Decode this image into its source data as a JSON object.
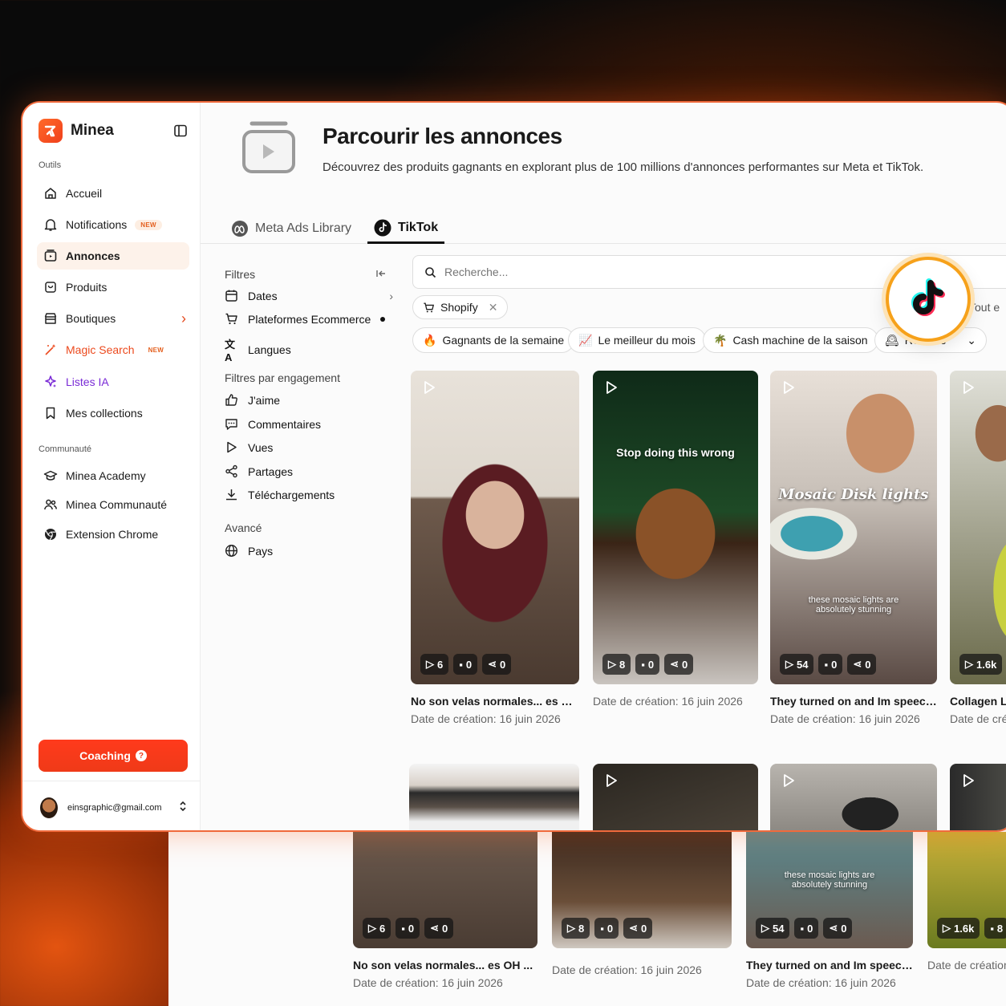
{
  "app": {
    "name": "Minea"
  },
  "sidebar": {
    "section_tools": "Outils",
    "items": [
      {
        "label": "Accueil",
        "icon": "home-icon"
      },
      {
        "label": "Notifications",
        "icon": "bell-icon",
        "badge": "NEW"
      },
      {
        "label": "Annonces",
        "icon": "ads-icon",
        "active": true
      },
      {
        "label": "Produits",
        "icon": "product-icon"
      },
      {
        "label": "Boutiques",
        "icon": "store-icon"
      },
      {
        "label": "Magic Search",
        "icon": "magic-wand-icon",
        "badge": "NEW"
      },
      {
        "label": "Listes IA",
        "icon": "sparkle-icon"
      },
      {
        "label": "Mes collections",
        "icon": "bookmark-icon"
      }
    ],
    "section_community": "Communauté",
    "community": [
      {
        "label": "Minea Academy",
        "icon": "graduation-icon"
      },
      {
        "label": "Minea Communauté",
        "icon": "users-icon"
      },
      {
        "label": "Extension Chrome",
        "icon": "chrome-icon"
      }
    ],
    "coaching": "Coaching",
    "user_email": "einsgraphic@gmail.com"
  },
  "header": {
    "title": "Parcourir les annonces",
    "subtitle": "Découvrez des produits gagnants en explorant plus de 100 millions d'annonces performantes sur Meta et TikTok."
  },
  "tabs": [
    {
      "label": "Meta Ads Library"
    },
    {
      "label": "TikTok",
      "active": true
    }
  ],
  "filters": {
    "title": "Filtres",
    "items": [
      "Dates",
      "Plateformes Ecommerce",
      "Langues"
    ],
    "engagement_title": "Filtres par engagement",
    "engagement": [
      "J'aime",
      "Commentaires",
      "Vues",
      "Partages",
      "Téléchargements"
    ],
    "advanced_title": "Avancé",
    "advanced": [
      "Pays"
    ]
  },
  "search": {
    "placeholder": "Recherche..."
  },
  "active_chip": "Shopify",
  "tout_label": "Tout e",
  "presets": [
    {
      "emoji": "🔥",
      "label": "Gagnants de la semaine"
    },
    {
      "emoji": "📈",
      "label": "Le meilleur du mois"
    },
    {
      "emoji": "🌴",
      "label": "Cash machine de la saison"
    },
    {
      "emoji": "🕰",
      "label": "Récents"
    }
  ],
  "cards": [
    {
      "title": "No son velas normales... es OH ...",
      "date": "Date de création: 16 juin 2026",
      "views": "6",
      "comments": "0",
      "shares": "0",
      "overlay": "",
      "overlay2": ""
    },
    {
      "title": "",
      "date": "Date de création: 16 juin 2026",
      "views": "8",
      "comments": "0",
      "shares": "0",
      "overlay": "Stop doing this wrong",
      "overlay2": ""
    },
    {
      "title": "They turned on and Im speechl...",
      "date": "Date de création: 16 juin 2026",
      "views": "54",
      "comments": "0",
      "shares": "0",
      "overlay": "Mosaic Disk lights",
      "overlay2": "these mosaic lights are absolutely stunning"
    },
    {
      "title": "Collagen Le",
      "date": "Date de créa",
      "views": "1.6k",
      "comments": "",
      "shares": "",
      "overlay": "",
      "overlay2": ""
    }
  ],
  "bottom_cards": [
    {
      "title": "No son velas normales... es OH ...",
      "date": "Date de création: 16 juin 2026",
      "views": "6",
      "comments": "0",
      "shares": "0"
    },
    {
      "title": "",
      "date": "Date de création: 16 juin 2026",
      "views": "8",
      "comments": "0",
      "shares": "0"
    },
    {
      "title": "They turned on and Im speechl...",
      "date": "Date de création: 16 juin 2026",
      "views": "54",
      "comments": "0",
      "shares": "0",
      "overlay2": "these mosaic lights are absolutely stunning"
    },
    {
      "title": "",
      "date": "Date de création",
      "views": "1.6k",
      "comments": "8",
      "shares": ""
    }
  ],
  "colors": {
    "accent": "#f0401c",
    "active_bg": "#fdf2ea",
    "magic": "#ec4a1e",
    "lists": "#7a2bd6"
  }
}
